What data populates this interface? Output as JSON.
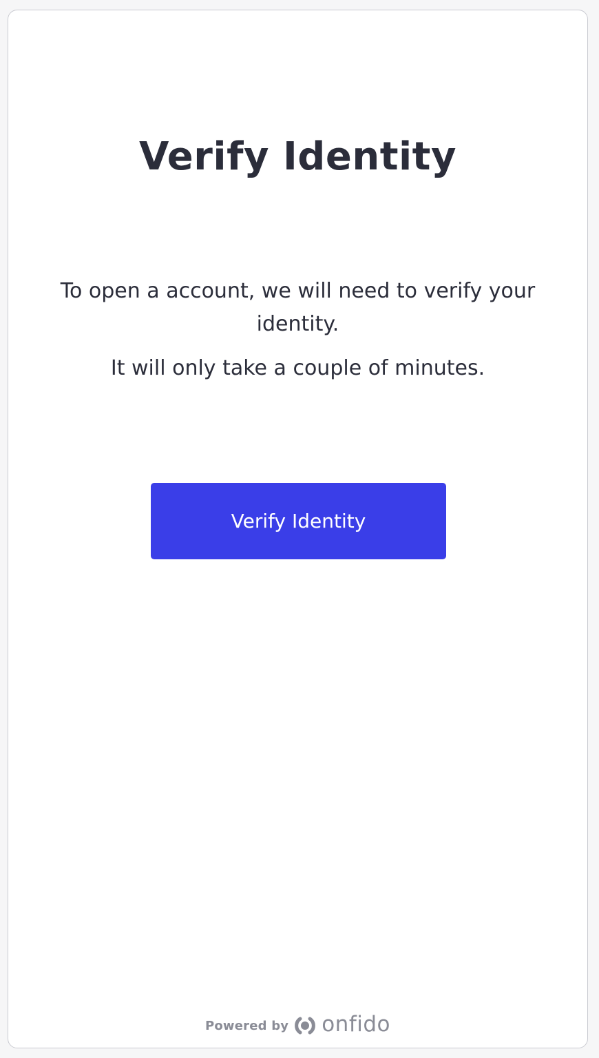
{
  "page": {
    "title": "Verify Identity",
    "description_lines": [
      "To open a account, we will need to verify your identity.",
      "It will only take a couple of minutes."
    ],
    "cta_label": "Verify Identity"
  },
  "footer": {
    "powered_by": "Powered by",
    "brand": "onfido",
    "brand_icon": "onfido-logo-icon"
  },
  "colors": {
    "primary": "#3a3ee8",
    "text": "#2b2d3a",
    "muted": "#8a8c96",
    "border": "#c9cad1",
    "background": "#f6f6f7"
  }
}
